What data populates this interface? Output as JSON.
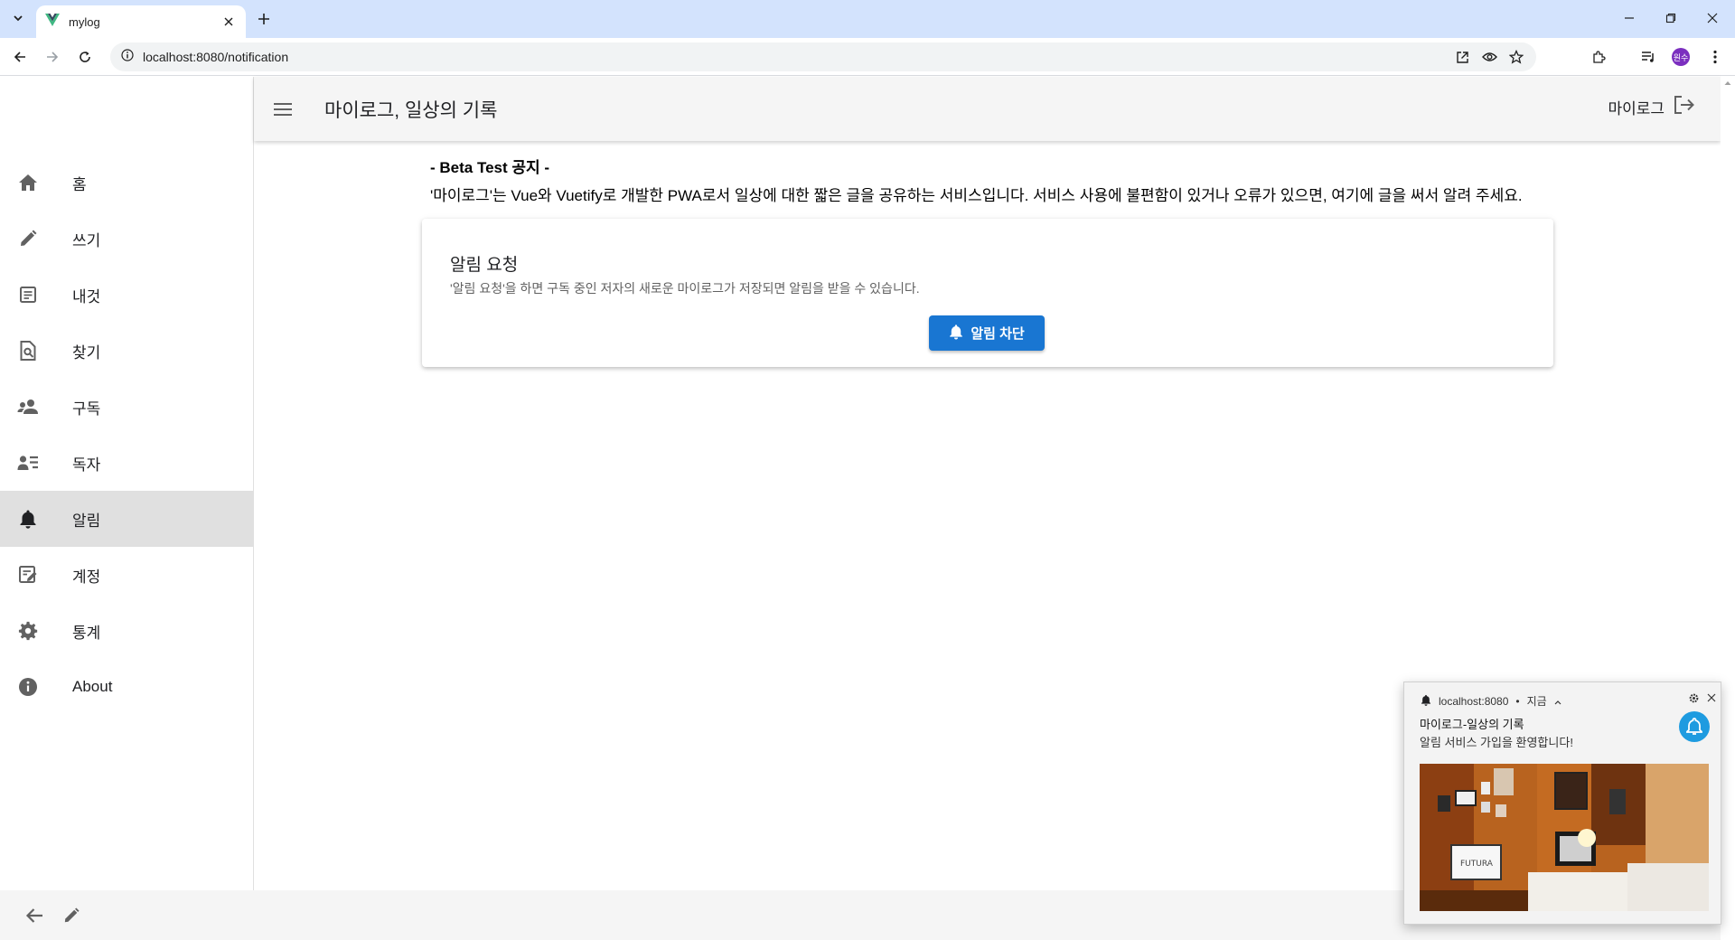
{
  "browser": {
    "tab_title": "mylog",
    "url": "localhost:8080/notification",
    "profile_initials": "원수"
  },
  "nav": {
    "items": [
      {
        "label": "홈",
        "icon": "home-icon"
      },
      {
        "label": "쓰기",
        "icon": "pencil-icon"
      },
      {
        "label": "내것",
        "icon": "article-icon"
      },
      {
        "label": "찾기",
        "icon": "find-in-page-icon"
      },
      {
        "label": "구독",
        "icon": "people-icon"
      },
      {
        "label": "독자",
        "icon": "contact-list-icon"
      },
      {
        "label": "알림",
        "icon": "bell-icon",
        "active": true
      },
      {
        "label": "계정",
        "icon": "edit-note-icon"
      },
      {
        "label": "통계",
        "icon": "gear-icon"
      },
      {
        "label": "About",
        "icon": "info-icon"
      }
    ]
  },
  "appbar": {
    "title": "마이로그, 일상의 기록",
    "user_label": "마이로그"
  },
  "notice": {
    "title": "- Beta Test 공지 -",
    "body": "'마이로그'는 Vue와 Vuetify로 개발한 PWA로서 일상에 대한 짧은 글을 공유하는 서비스입니다. 서비스 사용에 불편함이 있거나 오류가 있으면, 여기에 글을 써서 알려 주세요."
  },
  "card": {
    "title": "알림 요청",
    "subtitle": "'알림 요청'을 하면 구독 중인 저자의 새로운 마이로그가 저장되면 알림을 받을 수 있습니다.",
    "button_label": "알림 차단"
  },
  "toast": {
    "source": "localhost:8080",
    "separator": "•",
    "time": "지금",
    "title": "마이로그-일상의 기록",
    "message": "알림 서비스 가입을 환영합니다!",
    "image_sign_text": "FUTURA"
  },
  "colors": {
    "primary": "#1976d2",
    "active_nav_bg": "#e0e0e0",
    "appbar_bg": "#f5f5f5",
    "tabstrip_bg": "#d3e3fd"
  }
}
